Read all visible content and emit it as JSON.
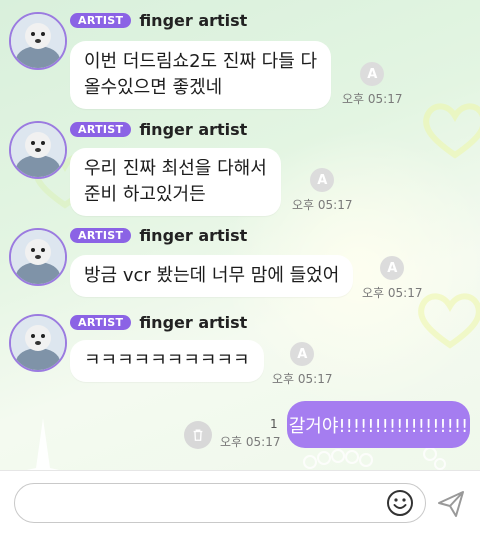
{
  "colors": {
    "accent": "#8b63e5",
    "my_bubble": "#a57df0",
    "background": "#e3f5e2"
  },
  "messages": [
    {
      "badge": "ARTIST",
      "sender": "finger artist",
      "text": "이번 더드림쇼2도 진짜 다들 다\n올수있으면 좋겠네",
      "time": "오후 05:17",
      "reaction_icon": "reaction-add-icon"
    },
    {
      "badge": "ARTIST",
      "sender": "finger artist",
      "text": "우리 진짜 최선을 다해서\n준비 하고있거든",
      "time": "오후 05:17",
      "reaction_icon": "reaction-add-icon"
    },
    {
      "badge": "ARTIST",
      "sender": "finger artist",
      "text": "방금 vcr 봤는데 너무 맘에 들었어",
      "time": "오후 05:17",
      "reaction_icon": "reaction-add-icon"
    },
    {
      "badge": "ARTIST",
      "sender": "finger artist",
      "text": "ㅋㅋㅋㅋㅋㅋㅋㅋㅋㅋ",
      "time": "오후 05:17",
      "reaction_icon": "reaction-add-icon"
    }
  ],
  "my_message": {
    "text": "갈거야!!!!!!!!!!!!!!!!!!",
    "unread_count": "1",
    "time": "오후 05:17",
    "delete_icon": "trash-icon"
  },
  "composer": {
    "placeholder": "",
    "emoji_icon": "smiley-icon",
    "send_icon": "send-icon"
  }
}
